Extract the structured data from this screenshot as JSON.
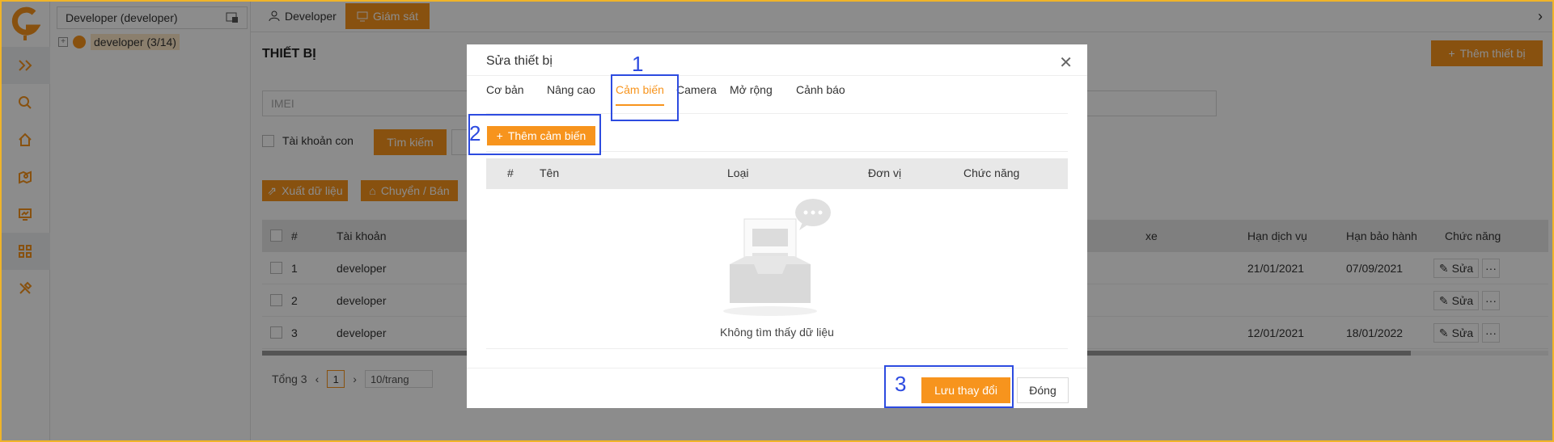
{
  "sidebar_tree": {
    "header": "Developer (developer)",
    "node_label": "developer (3/14)"
  },
  "rail_icons": [
    "logo-icon",
    "expand-icon",
    "search-icon",
    "home-icon",
    "map-icon",
    "monitor-chart-icon",
    "grid-icon",
    "tools-icon"
  ],
  "top_tabs": [
    {
      "label": "Developer",
      "icon": "user-icon"
    },
    {
      "label": "Giám sát",
      "icon": "monitor-icon"
    }
  ],
  "page": {
    "title": "THIẾT BỊ",
    "add_device_label": "Thêm thiết bị",
    "imei_placeholder": "IMEI",
    "sub_account_label": "Tài khoản con",
    "search_label": "Tìm kiếm",
    "export_label": "Xuất dữ liệu",
    "transfer_label": "Chuyển / Bán"
  },
  "table": {
    "headers": {
      "num": "#",
      "account": "Tài khoản",
      "vehicle": "xe",
      "service_expiry": "Hạn dịch vụ",
      "warranty_expiry": "Hạn bảo hành",
      "actions": "Chức năng"
    },
    "rows": [
      {
        "num": "1",
        "account": "developer",
        "service_expiry": "21/01/2021",
        "warranty_expiry": "07/09/2021",
        "edit": "Sửa"
      },
      {
        "num": "2",
        "account": "developer",
        "service_expiry": "",
        "warranty_expiry": "",
        "edit": "Sửa"
      },
      {
        "num": "3",
        "account": "developer",
        "service_expiry": "12/01/2021",
        "warranty_expiry": "18/01/2022",
        "edit": "Sửa"
      }
    ]
  },
  "pager": {
    "total": "Tổng 3",
    "page": "1",
    "per_page": "10/trang"
  },
  "modal": {
    "title": "Sửa thiết bị",
    "tabs": [
      "Cơ bản",
      "Nâng cao",
      "Cảm biến",
      "Camera",
      "Mở rộng",
      "Cảnh báo"
    ],
    "active_tab": "Cảm biến",
    "add_sensor_label": "Thêm cảm biến",
    "sensor_headers": {
      "num": "#",
      "name": "Tên",
      "type": "Loại",
      "unit": "Đơn vị",
      "actions": "Chức năng"
    },
    "empty_text": "Không tìm thấy dữ liệu",
    "save_label": "Lưu thay đổi",
    "close_label": "Đóng"
  },
  "annotations": [
    "1",
    "2",
    "3"
  ],
  "colors": {
    "accent": "#f7941d",
    "annotation": "#2d4be0"
  }
}
